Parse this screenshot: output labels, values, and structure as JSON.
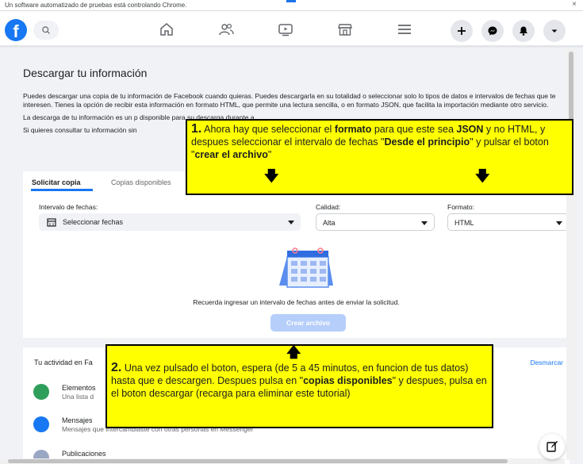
{
  "browser": {
    "automation_notice": "Un software automatizado de pruebas está controlando Chrome.",
    "close_symbol": "×"
  },
  "nav": {
    "logo_letter": "f",
    "icons": [
      "search-icon",
      "home-icon",
      "friends-icon",
      "watch-icon",
      "marketplace-icon",
      "menu-icon",
      "plus-icon",
      "messenger-icon",
      "notifications-icon",
      "account-caret-icon"
    ]
  },
  "page": {
    "title": "Descargar tu información",
    "intro_p1": "Puedes descargar una copia de tu información de Facebook cuando quieras. Puedes descargarla en su totalidad o seleccionar solo lo tipos de datos e intervalos de fechas que te interesen. Tienes la opción de recibir esta información en formato HTML, que permite una lectura sencilla, o en formato JSON, que facilita la importación mediante otro servicio.",
    "intro_p2": "La descarga de tu información es un p disponible para su descarga durante a",
    "intro_p3": "Si quieres consultar tu información sin"
  },
  "tabs": {
    "solicitar": "Solicitar copia",
    "disponibles": "Copias disponibles"
  },
  "form": {
    "interval_label": "Intervalo de fechas:",
    "interval_value": "Seleccionar fechas",
    "calidad_label": "Calidad:",
    "calidad_value": "Alta",
    "formato_label": "Formato:",
    "formato_value": "HTML",
    "reminder": "Recuerda ingresar un intervalo de fechas antes de enviar la solicitud.",
    "create_button": "Crear archivo"
  },
  "activity": {
    "title": "Tu actividad en Fa",
    "unselect": "Desmarcar",
    "rows": [
      {
        "name": "Elementos",
        "desc": "Una lista d"
      },
      {
        "name": "Mensajes",
        "desc": "Mensajes que intercambiaste con otras personas en Messenger"
      },
      {
        "name": "Publicaciones",
        "desc": ""
      }
    ]
  },
  "notes": {
    "n1_number": "1.",
    "n1_a": " Ahora hay que seleccionar el ",
    "n1_b": "formato",
    "n1_c": " para que este sea ",
    "n1_d": "JSON",
    "n1_e": " y no HTML, y despues seleccionar el intervalo de fechas \"",
    "n1_f": "Desde el principio",
    "n1_g": "\" y pulsar el boton \"",
    "n1_h": "crear el archivo",
    "n1_i": "\"",
    "n2_number": "2.",
    "n2_a": " Una vez pulsado el boton, espera (de 5 a 45 minutos, en funcion de tus datos) hasta que e descargen. Despues pulsa en \"",
    "n2_b": "copias disponibles",
    "n2_c": "\" y despues, pulsa en el boton descargar (recarga para eliminar este tutorial)",
    "down_arrow": "🡇",
    "up_arrow": "🡅"
  },
  "colors": {
    "fb_blue": "#1877f2",
    "note_yellow": "#ffff00"
  }
}
